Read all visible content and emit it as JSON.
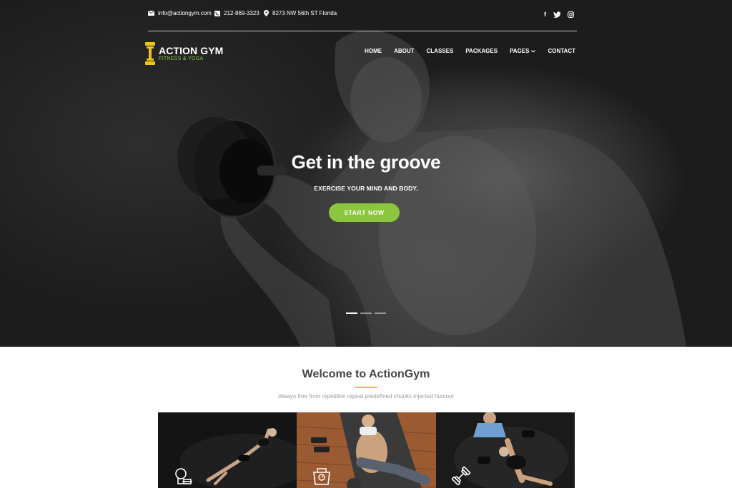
{
  "topbar": {
    "email": "info@actiongym.com",
    "phone": "212-869-3323",
    "address": "8273 NW 56th ST Florida",
    "social": [
      "facebook-icon",
      "twitter-icon",
      "instagram-icon"
    ]
  },
  "logo": {
    "title": "ACTION GYM",
    "tagline": "FITNESS & YOGA"
  },
  "nav": {
    "items": [
      "HOME",
      "ABOUT",
      "CLASSES",
      "PACKAGES",
      "PAGES",
      "CONTACT"
    ]
  },
  "hero": {
    "title": "Get in the groove",
    "subtitle": "EXERCISE YOUR MIND AND BODY.",
    "cta": "START NOW",
    "slides": 3,
    "active_slide": 1
  },
  "welcome": {
    "title": "Welcome to ActionGym",
    "subtitle": "Always free from repetition repeat predefined chunks injected humour"
  },
  "tiles": [
    {
      "icon": "kettlebell-icon"
    },
    {
      "icon": "scale-icon"
    },
    {
      "icon": "dumbbell-icon"
    }
  ],
  "colors": {
    "accent": "#8cc63f",
    "logo_yellow": "#f2c318",
    "title_gray": "#444444"
  }
}
